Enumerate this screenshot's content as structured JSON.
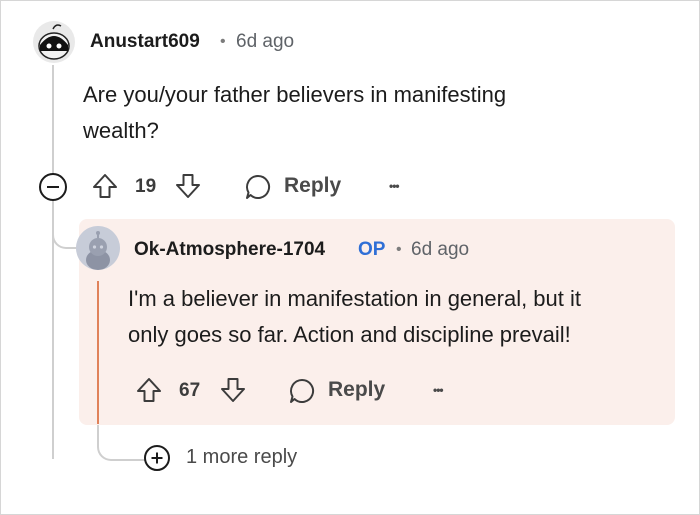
{
  "comment": {
    "username": "Anustart609",
    "separator": "•",
    "time": "6d ago",
    "body_line1": "Are you/your father believers in manifesting",
    "body_line2": "wealth?",
    "votes": "19",
    "reply_label": "Reply",
    "more_label": "•••"
  },
  "reply": {
    "username": "Ok-Atmosphere-1704",
    "op_badge": "OP",
    "separator": "•",
    "time": "6d ago",
    "body_line1": "I'm a believer in manifestation in general, but it",
    "body_line2": "only goes so far. Action and discipline prevail!",
    "votes": "67",
    "reply_label": "Reply",
    "more_label": "•••"
  },
  "more_replies": {
    "label": "1 more reply"
  },
  "colors": {
    "op": "#2f6fd6",
    "highlight_bg": "#fbefeb",
    "accent": "#e0825a"
  },
  "icons": [
    "collapse-minus-icon",
    "upvote-arrow-icon",
    "downvote-arrow-icon",
    "comment-bubble-icon",
    "more-dots-icon",
    "expand-plus-icon"
  ]
}
